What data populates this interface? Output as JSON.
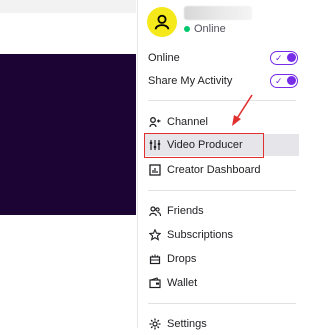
{
  "profile": {
    "status_text": "Online"
  },
  "toggles": [
    {
      "label": "Online",
      "on": true
    },
    {
      "label": "Share My Activity",
      "on": true
    }
  ],
  "menu": {
    "channel": "Channel",
    "video_producer": "Video Producer",
    "creator_dashboard": "Creator Dashboard",
    "friends": "Friends",
    "subscriptions": "Subscriptions",
    "drops": "Drops",
    "wallet": "Wallet",
    "settings": "Settings"
  },
  "colors": {
    "accent": "#772ce8",
    "avatar": "#f5e91b",
    "online_dot": "#00c76b",
    "annotation": "#e03030",
    "video_bg": "#1c0434"
  },
  "annotations": {
    "highlighted_item": "video_producer"
  }
}
